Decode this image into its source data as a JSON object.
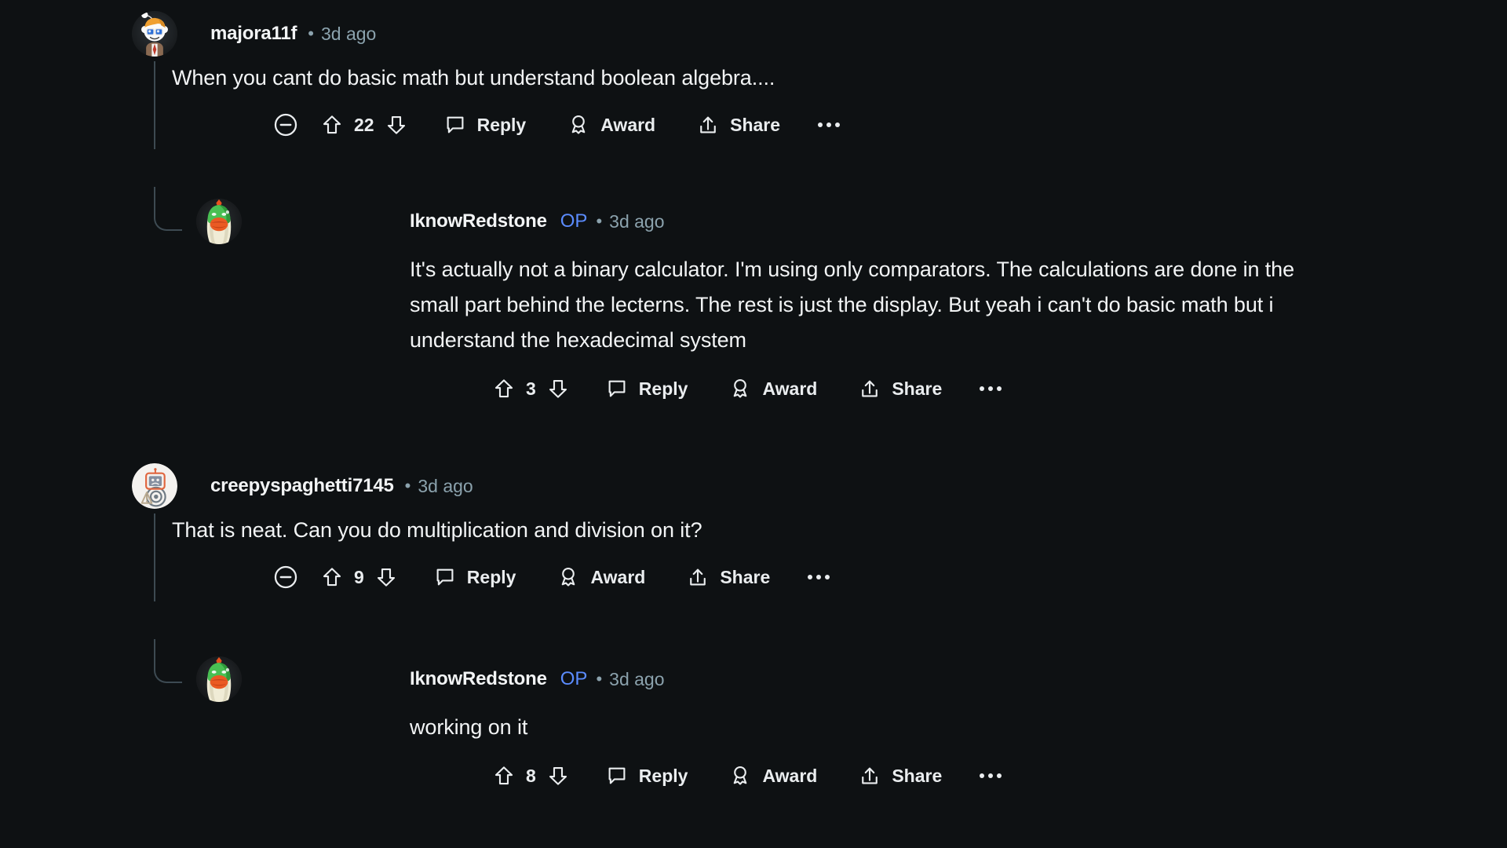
{
  "theme": {
    "background": "#0e1113",
    "text_primary": "#f2f4f5",
    "text_muted": "#8ba2ad",
    "op_color": "#5b8cff",
    "thread_line": "#3d4a52"
  },
  "comments": [
    {
      "id": "c1",
      "author": "majora11f",
      "is_op": false,
      "op_label": "",
      "separator": "•",
      "timestamp": "3d ago",
      "body": "When you cant do basic math but understand boolean algebra....",
      "score": "22",
      "has_collapse": true,
      "actions": {
        "collapse": "collapse-comment",
        "upvote": "upvote",
        "downvote": "downvote",
        "reply_label": "Reply",
        "award_label": "Award",
        "share_label": "Share",
        "more_label": "more-options"
      },
      "replies": [
        {
          "id": "c1r1",
          "author": "IknowRedstone",
          "is_op": true,
          "op_label": "OP",
          "separator": "•",
          "timestamp": "3d ago",
          "body": "It's actually not a binary calculator. I'm using only comparators. The calculations are done in the small part behind the lecterns. The rest is just the display. But yeah i can't do basic math but i understand the hexadecimal system",
          "score": "3",
          "has_collapse": false,
          "actions": {
            "upvote": "upvote",
            "downvote": "downvote",
            "reply_label": "Reply",
            "award_label": "Award",
            "share_label": "Share",
            "more_label": "more-options"
          }
        }
      ]
    },
    {
      "id": "c2",
      "author": "creepyspaghetti7145",
      "is_op": false,
      "op_label": "",
      "separator": "•",
      "timestamp": "3d ago",
      "body": "That is neat. Can you do multiplication and division on it?",
      "score": "9",
      "has_collapse": true,
      "actions": {
        "collapse": "collapse-comment",
        "upvote": "upvote",
        "downvote": "downvote",
        "reply_label": "Reply",
        "award_label": "Award",
        "share_label": "Share",
        "more_label": "more-options"
      },
      "replies": [
        {
          "id": "c2r1",
          "author": "IknowRedstone",
          "is_op": true,
          "op_label": "OP",
          "separator": "•",
          "timestamp": "3d ago",
          "body": "working on it",
          "score": "8",
          "has_collapse": false,
          "actions": {
            "upvote": "upvote",
            "downvote": "downvote",
            "reply_label": "Reply",
            "award_label": "Award",
            "share_label": "Share",
            "more_label": "more-options"
          }
        }
      ]
    }
  ]
}
